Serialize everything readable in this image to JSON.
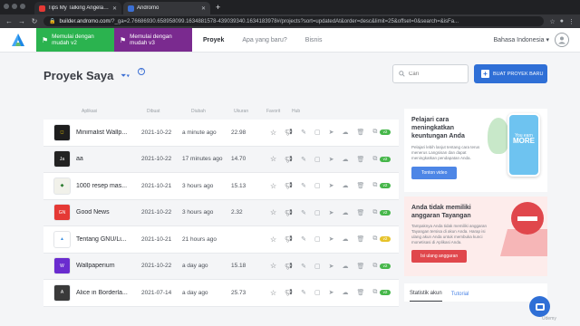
{
  "browser": {
    "tabs": [
      {
        "label": "Tips My Talking Angela 2 and",
        "color": "#e53935"
      },
      {
        "label": "Andromo",
        "color": "#3b6fd4"
      }
    ],
    "new_tab": "+",
    "url_host": "builder.andromo.com",
    "url_rest": "/?_ga=2.76686930.658958099.1634881578-439039340.1634183978#/projects?sort=updatedAt&order=desc&limit=25&offset=0&search=&isFa..."
  },
  "header": {
    "btn_v2": "Memulai dengan mudah v2",
    "btn_v3": "Memulai dengan mudah v3",
    "nav": [
      "Proyek",
      "Apa yang baru?",
      "Bisnis"
    ],
    "language": "Bahasa Indonesia"
  },
  "page": {
    "title": "Proyek Saya",
    "search_placeholder": "Cari",
    "create_label": "BUAT PROYEK BARU"
  },
  "columns": [
    "Aplikasi",
    "Dibuat",
    "Diubah",
    "Ukuran",
    "Favorit",
    "Hub"
  ],
  "apps": [
    {
      "name": "Minimalist Wallp...",
      "created": "2021-10-22",
      "updated": "a minute ago",
      "size": "22.98",
      "count": "v2",
      "icon_bg": "#1e1e1e",
      "icon_fg": "#f5d000",
      "icon_text": "◻"
    },
    {
      "name": "aa",
      "created": "2021-10-22",
      "updated": "17 minutes ago",
      "size": "14.70",
      "count": "v2",
      "icon_bg": "#222222",
      "icon_fg": "#ffffff",
      "icon_text": "Ja"
    },
    {
      "name": "1000 resep mas...",
      "created": "2021-10-21",
      "updated": "3 hours ago",
      "size": "15.13",
      "count": "v2",
      "icon_bg": "#f1f1ea",
      "icon_fg": "#2e7d32",
      "icon_text": "◆"
    },
    {
      "name": "Good News",
      "created": "2021-10-22",
      "updated": "3 hours ago",
      "size": "2.32",
      "count": "v2",
      "icon_bg": "#e53935",
      "icon_fg": "#ffffff",
      "icon_text": "GN"
    },
    {
      "name": "Tentang GNU/Li...",
      "created": "2021-10-21",
      "updated": "21 hours ago",
      "size": "",
      "count": "v2",
      "icon_bg": "#ffffff",
      "icon_fg": "#3b8fe0",
      "icon_text": "▲"
    },
    {
      "name": "Wallpaperium",
      "created": "2021-10-22",
      "updated": "a day ago",
      "size": "15.18",
      "count": "v2",
      "icon_bg": "#6a2ccf",
      "icon_fg": "#ffffff",
      "icon_text": "W"
    },
    {
      "name": "Alice in Borderla...",
      "created": "2021-07-14",
      "updated": "a day ago",
      "size": "25.73",
      "count": "v2",
      "icon_bg": "#3a3a3a",
      "icon_fg": "#ffffff",
      "icon_text": "A"
    }
  ],
  "count_colors": [
    "#45b649",
    "#45b649",
    "#45b649",
    "#45b649",
    "#e6c229",
    "#45b649",
    "#45b649"
  ],
  "panel": {
    "card1_title": "Pelajari cara meningkatkan keuntungan Anda",
    "card1_text": "Pelajari lebih lanjut tentang cara terus menerus Langsisan dan dapat meningkatkan pendapatan Anda.",
    "card1_button": "Tonton video",
    "phone_text": "You earn",
    "phone_big": "MORE",
    "card2_title": "Anda tidak memiliki anggaran Tayangan",
    "card2_text": "Tampaknya Anda tidak memiliki anggaran Tayangan tersisa di akun Anda. Harap isi ulang akun Anda untuk membuka kunci monetisasi di Aplikasi Anda.",
    "card2_button": "Isi ulang anggaran",
    "tab1": "Statistik akun",
    "tab2": "Tutorial"
  },
  "watermark": "Udemy"
}
